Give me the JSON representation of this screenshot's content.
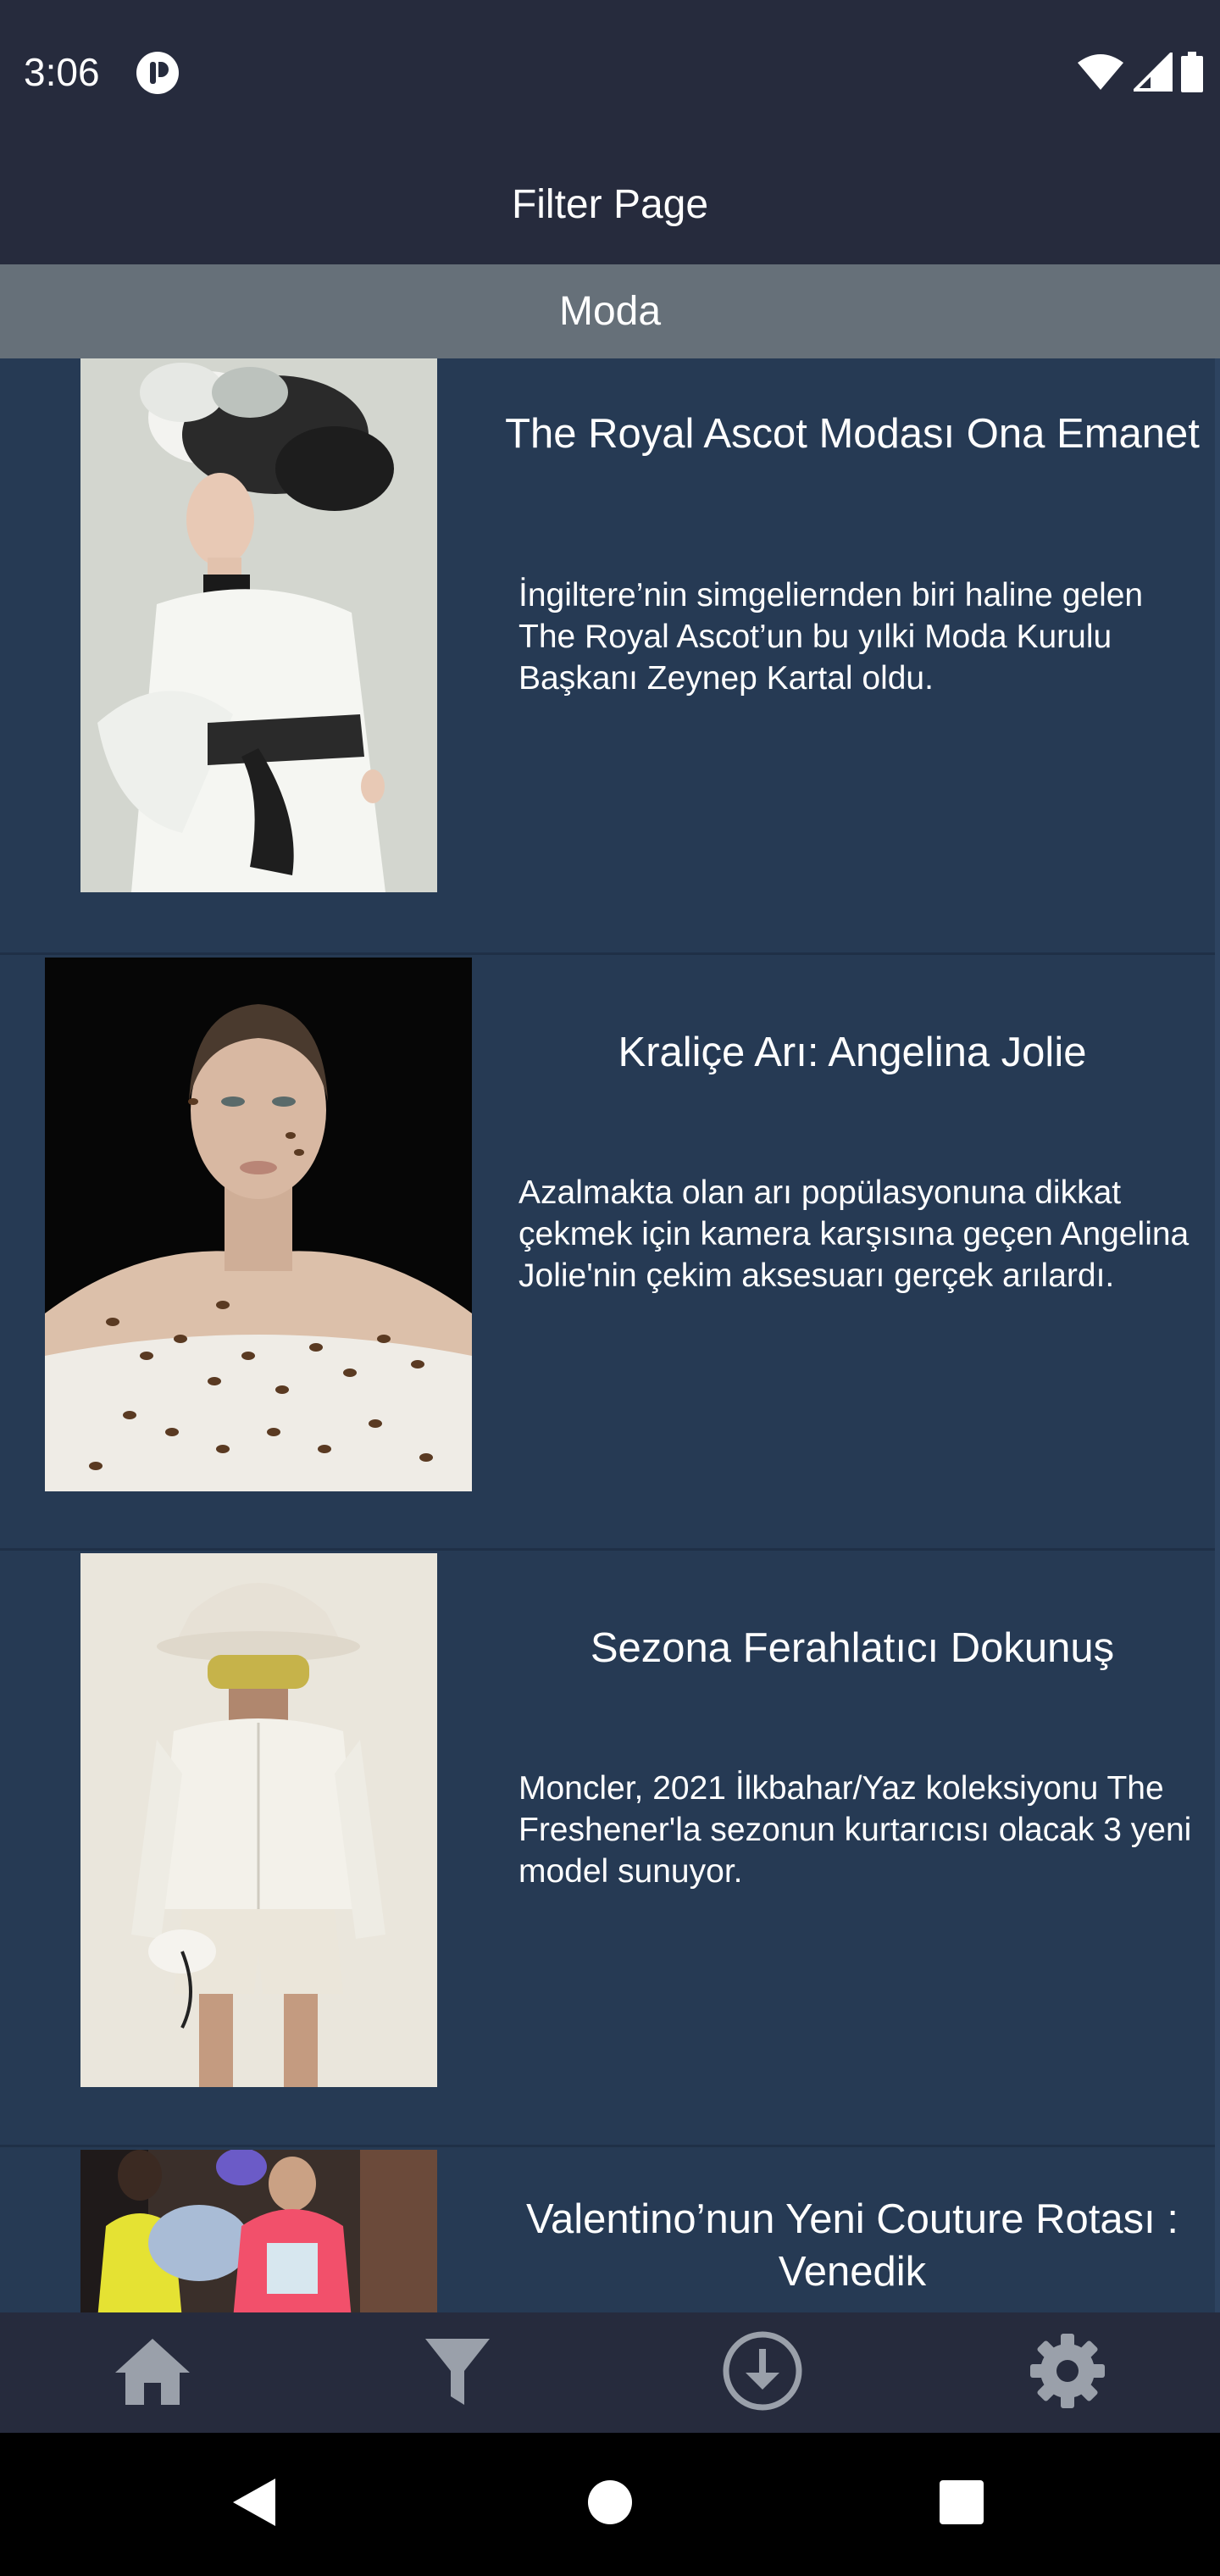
{
  "status_bar": {
    "time": "3:06"
  },
  "header": {
    "title": "Filter Page"
  },
  "category": {
    "label": "Moda"
  },
  "articles": [
    {
      "title": "The Royal Ascot Modası Ona Emanet",
      "description": "İngiltere’nin simgeliernden biri haline gelen The Royal Ascot’un bu yılki Moda Kurulu Başkanı Zeynep Kartal oldu.",
      "image": "woman-feather-headdress-white-coat"
    },
    {
      "title": "Kraliçe Arı: Angelina Jolie",
      "description": "Azalmakta olan arı popülasyonuna dikkat çekmek için kamera karşısına geçen Angelina Jolie'nin çekim aksesuarı gerçek arılardı.",
      "image": "woman-portrait-with-bees"
    },
    {
      "title": "Sezona Ferahlatıcı Dokunuş",
      "description": "Moncler, 2021 İlkbahar/Yaz koleksiyonu The Freshener'la sezonun kurtarıcısı olacak 3 yeni model sunuyor.",
      "image": "model-white-outfit-bucket-hat"
    },
    {
      "title": "Valentino’nun Yeni Couture Rotası : Venedik",
      "description": "",
      "image": "runway-models-couture"
    }
  ],
  "bottom_nav": {
    "items": [
      {
        "icon": "home-icon"
      },
      {
        "icon": "filter-icon"
      },
      {
        "icon": "download-icon"
      },
      {
        "icon": "settings-icon"
      }
    ]
  },
  "colors": {
    "app_bar": "#262b3d",
    "category_bar": "#667079",
    "list_background": "#263a54",
    "text": "#ffffff",
    "nav_icon": "#9aa0aa"
  }
}
